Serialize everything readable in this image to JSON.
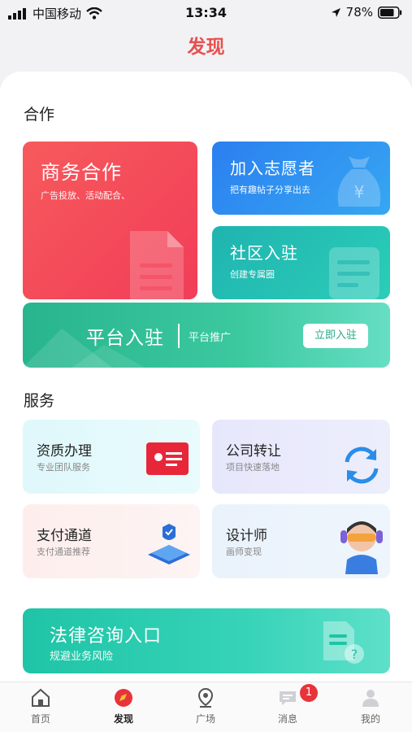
{
  "status_bar": {
    "carrier": "中国移动",
    "time": "13:34",
    "battery": "78%"
  },
  "header": {
    "title": "发现"
  },
  "cooperation": {
    "title": "合作",
    "business": {
      "title": "商务合作",
      "subtitle": "广告投放、活动配合、"
    },
    "volunteer": {
      "title": "加入志愿者",
      "subtitle": "把有趣帖子分享出去"
    },
    "community": {
      "title": "社区入驻",
      "subtitle": "创建专属圈"
    },
    "platform": {
      "title": "平台入驻",
      "subtitle": "平台推广",
      "button": "立即入驻"
    }
  },
  "services": {
    "title": "服务",
    "items": [
      {
        "title": "资质办理",
        "subtitle": "专业团队服务"
      },
      {
        "title": "公司转让",
        "subtitle": "项目快速落地"
      },
      {
        "title": "支付通道",
        "subtitle": "支付通道推荐"
      },
      {
        "title": "设计师",
        "subtitle": "画师变现"
      }
    ]
  },
  "legal": {
    "title": "法律咨询入口",
    "subtitle": "规避业务风险"
  },
  "tabs": [
    {
      "label": "首页",
      "icon": "home-icon"
    },
    {
      "label": "发现",
      "icon": "compass-icon"
    },
    {
      "label": "广场",
      "icon": "pin-icon"
    },
    {
      "label": "消息",
      "icon": "message-icon"
    },
    {
      "label": "我的",
      "icon": "user-icon"
    }
  ],
  "messages_badge": "1",
  "colors": {
    "accent": "#e8504f",
    "red_tile": "#f4475a",
    "blue_tile": "#2a8ef0",
    "teal_tile": "#22c1b7",
    "green_tile": "#36c39a"
  }
}
